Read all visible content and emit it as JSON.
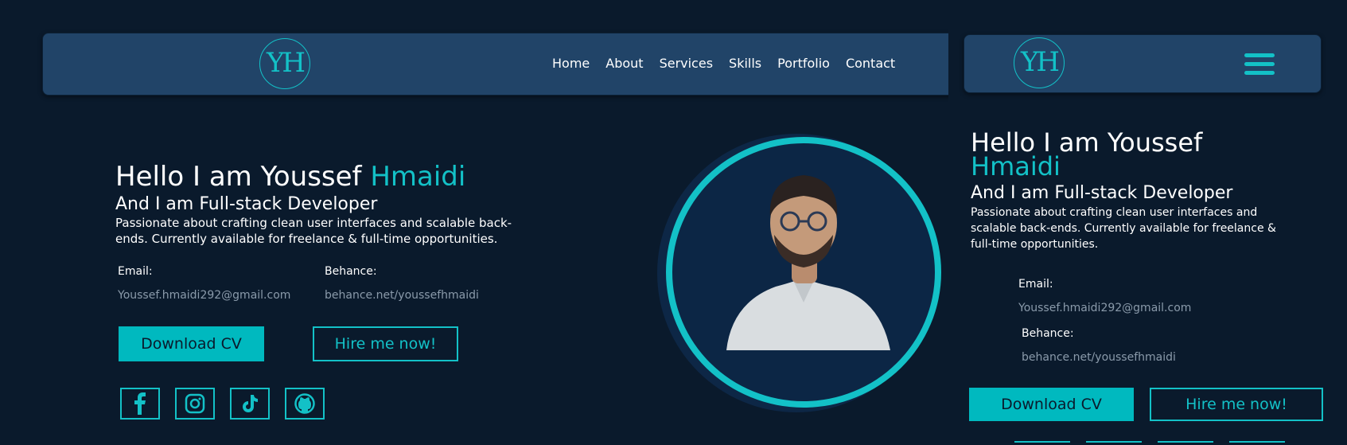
{
  "logo": {
    "text": "YH"
  },
  "nav": {
    "links": [
      "Home",
      "About",
      "Services",
      "Skills",
      "Portfolio",
      "Contact"
    ]
  },
  "hero": {
    "greeting": "Hello I am Youssef ",
    "name": "Hmaidi",
    "role": "And I am Full-stack Developer",
    "description": "Passionate about crafting clean user interfaces and scalable back-ends. Currently available for freelance & full-time opportunities."
  },
  "contact": {
    "email_label": "Email:",
    "email_value": "Youssef.hmaidi292@gmail.com",
    "behance_label": "Behance:",
    "behance_value": "behance.net/youssefhmaidi"
  },
  "buttons": {
    "download_cv": "Download CV",
    "hire_me": "Hire me now!"
  },
  "social": [
    "facebook-icon",
    "instagram-icon",
    "tiktok-icon",
    "github-icon"
  ],
  "mobile": {
    "greeting": "Hello I am Youssef",
    "name": "Hmaidi",
    "role": "And I am Full-stack Developer",
    "description": "Passionate about crafting clean user interfaces and scalable back-ends. Currently available for freelance & full-time opportunities."
  },
  "colors": {
    "background": "#0a1a2c",
    "navbar": "#214468",
    "accent": "#13c1c7",
    "button_fill": "#00b9bf",
    "muted_text": "#8a9aaa"
  }
}
